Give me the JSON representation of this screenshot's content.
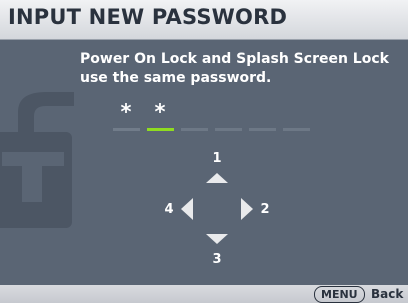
{
  "header": {
    "title": "INPUT NEW PASSWORD"
  },
  "message": {
    "line1": "Power On Lock and Splash Screen Lock",
    "line2": "use the same password."
  },
  "password": {
    "entered": [
      "*",
      "*"
    ],
    "total_digits": 6,
    "active_index": 1
  },
  "keypad": {
    "up": "1",
    "right": "2",
    "down": "3",
    "left": "4"
  },
  "icons": {
    "watermark": "lock-icon",
    "up": "arrow-up-icon",
    "right": "arrow-right-icon",
    "down": "arrow-down-icon",
    "left": "arrow-left-icon"
  },
  "footer": {
    "menu_key": "MENU",
    "back_label": "Back"
  },
  "colors": {
    "header_bg": "#e4e6ea",
    "content_bg": "#5a6574",
    "active_digit": "#8fdc20",
    "text": "#ffffff"
  }
}
